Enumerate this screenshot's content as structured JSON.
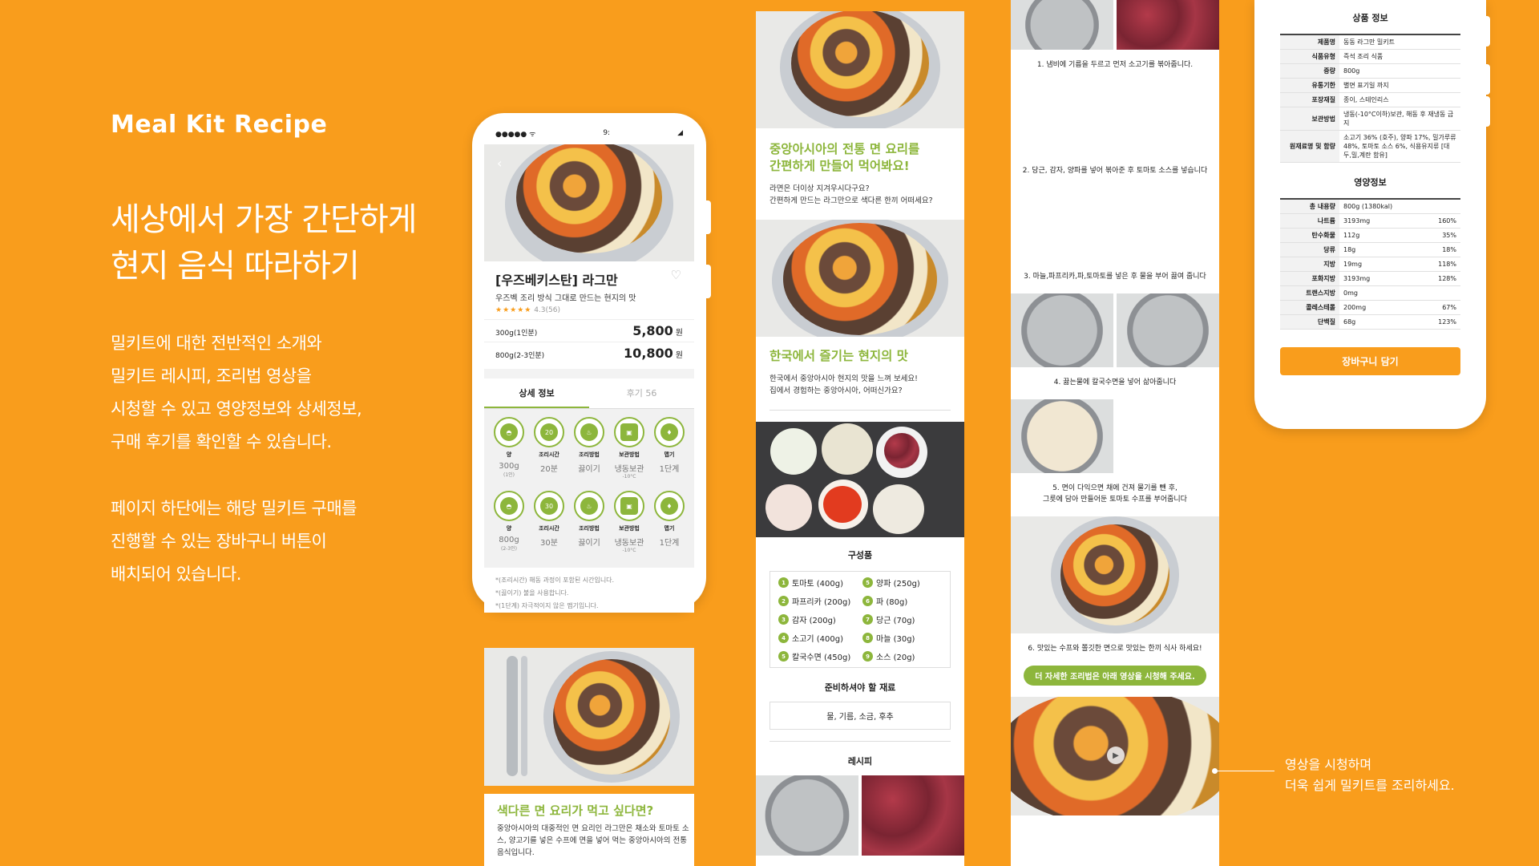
{
  "intro": {
    "brand": "Meal Kit Recipe",
    "headline_1": "세상에서 가장 간단하게",
    "headline_2": "현지 음식 따라하기",
    "desc_a": [
      "밀키트에 대한 전반적인 소개와",
      "밀키트 레시피, 조리법 영상을",
      "시청할 수 있고 영양정보와 상세정보,",
      "구매 후기를 확인할 수 있습니다."
    ],
    "desc_b": [
      "페이지 하단에는 해당 밀키트 구매를",
      "진행할 수 있는 장바구니 버튼이",
      "배치되어 있습니다."
    ]
  },
  "phone": {
    "status_left": "●●●●● ᯤ",
    "status_center": "9:",
    "product_title": "[우즈베키스탄] 라그만",
    "product_sub": "우즈벡 조리 방식 그대로 만드는 현지의 맛",
    "stars": "★★★★★",
    "rating": "4.3(56)",
    "prices": [
      {
        "label": "300g(1인분)",
        "value": "5,800",
        "unit": "원"
      },
      {
        "label": "800g(2-3인분)",
        "value": "10,800",
        "unit": "원"
      }
    ],
    "tab_detail": "상세 정보",
    "tab_review": "후기 56",
    "info_rows": [
      [
        {
          "label": "양",
          "value": "300g",
          "sub": "(1인)"
        },
        {
          "label": "조리시간",
          "value": "20분",
          "badge": "20"
        },
        {
          "label": "조리방법",
          "value": "끓이기"
        },
        {
          "label": "보관방법",
          "value": "냉동보관",
          "sub": "-10°C"
        },
        {
          "label": "맵기",
          "value": "1단계"
        }
      ],
      [
        {
          "label": "양",
          "value": "800g",
          "sub": "(2-3인)"
        },
        {
          "label": "조리시간",
          "value": "30분",
          "badge": "30"
        },
        {
          "label": "조리방법",
          "value": "끓이기"
        },
        {
          "label": "보관방법",
          "value": "냉동보관",
          "sub": "-10°C"
        },
        {
          "label": "맵기",
          "value": "1단계"
        }
      ]
    ],
    "notes": [
      "*(조리시간) 해동 과정이 포함된 시간입니다.",
      "*(끓이기) 불을 사용합니다.",
      "*(1단계) 자극적이지 않은 맵기입니다."
    ],
    "cta_title": "색다른 면 요리가 먹고 싶다면?",
    "cta_body": "중앙아시아의 대중적인 면 요리인 라그만은 채소와 토마토 소스, 양고기를 넣은 수프에 면을 넣어 먹는 중앙아시아의 전통 음식입니다."
  },
  "panel2": {
    "title1_a": "중앙아시아의 전통 면 요리를",
    "title1_b": "간편하게 만들어 먹어봐요!",
    "body1_a": "라면은 더이상 지겨우시다구요?",
    "body1_b": "간편하게 만드는 라그만으로 색다른 한끼 어떠세요?",
    "title2": "한국에서 즐기는 현지의 맛",
    "body2_a": "한국에서 중앙아시아 현지의 맛을 느껴 보세요!",
    "body2_b": "집에서 경험하는 중앙아시아, 어떠신가요?",
    "components_title": "구성품",
    "ingredients": [
      {
        "n": "1",
        "name": "토마토 (400g)"
      },
      {
        "n": "5",
        "name": "양파 (250g)"
      },
      {
        "n": "2",
        "name": "파프리카 (200g)"
      },
      {
        "n": "6",
        "name": "파 (80g)"
      },
      {
        "n": "3",
        "name": "감자 (200g)"
      },
      {
        "n": "7",
        "name": "당근 (70g)"
      },
      {
        "n": "4",
        "name": "소고기 (400g)"
      },
      {
        "n": "8",
        "name": "마늘 (30g)"
      },
      {
        "n": "5",
        "name": "칼국수면 (450g)"
      },
      {
        "n": "9",
        "name": "소스 (20g)"
      }
    ],
    "prep_title": "준비하셔야 할 재료",
    "prep_items": "물, 기름, 소금, 후추",
    "recipe_title": "레시피"
  },
  "panel3": {
    "steps": [
      "1. 냄비에 기름을 두르고 먼저 소고기를 볶아줍니다.",
      "2. 당근, 감자, 양파를 넣어 볶아준 후 토마토 소스를 넣습니다",
      "3. 마늘,파프리카,파,토마토를 넣은 후 물을 부어 끓여 줍니다",
      "4. 끓는물에 칼국수면을 넣어 삶아줍니다",
      "5. 면이 다익으면 채에 건져 물기를 뺀 후,",
      "그릇에 담아 만들어둔 토마토 수프를 부어줍니다",
      "6. 맛있는 수프와 쫄깃한 면으로 맛있는 한끼 식사 하세요!"
    ],
    "video_pill": "더 자세한 조리법은 아래 영상을 시청해 주세요."
  },
  "panel4": {
    "product_info_title": "상품 정보",
    "product_info": [
      {
        "k": "제품명",
        "v": "동동 라그만 밀키트"
      },
      {
        "k": "식품유형",
        "v": "즉석 조리 식품"
      },
      {
        "k": "중량",
        "v": "800g"
      },
      {
        "k": "유통기한",
        "v": "별면 표기일 까지"
      },
      {
        "k": "포장재질",
        "v": "종이, 스테인리스"
      },
      {
        "k": "보관방법",
        "v": "냉동(-10°C이하)보관, 해동 후 재냉동 금지"
      },
      {
        "k": "원재료명 및 함량",
        "v": "소고기 36% (호주), 양파 17%, 밀가루류 48%, 토마토 소스 6%, 식용유지류 [대두,밀,계란 함유]"
      }
    ],
    "nutrition_title": "영양정보",
    "nutrition": [
      {
        "k": "총 내용량",
        "v": "800g (1380kal)",
        "p": ""
      },
      {
        "k": "나트륨",
        "v": "3193mg",
        "p": "160%"
      },
      {
        "k": "탄수화물",
        "v": "112g",
        "p": "35%"
      },
      {
        "k": "당류",
        "v": "18g",
        "p": "18%"
      },
      {
        "k": "지방",
        "v": "19mg",
        "p": "118%"
      },
      {
        "k": "포화지방",
        "v": "3193mg",
        "p": "128%"
      },
      {
        "k": "트랜스지방",
        "v": "0mg",
        "p": ""
      },
      {
        "k": "콜레스테롤",
        "v": "200mg",
        "p": "67%"
      },
      {
        "k": "단백질",
        "v": "68g",
        "p": "123%"
      }
    ],
    "cart_button": "장바구니 담기"
  },
  "callout": {
    "line1": "영상을 시청하며",
    "line2": "더욱 쉽게 밀키트를 조리하세요."
  },
  "colors": {
    "background": "#F99D1C",
    "accent_green": "#8DB63C",
    "star": "#F99D1C"
  }
}
